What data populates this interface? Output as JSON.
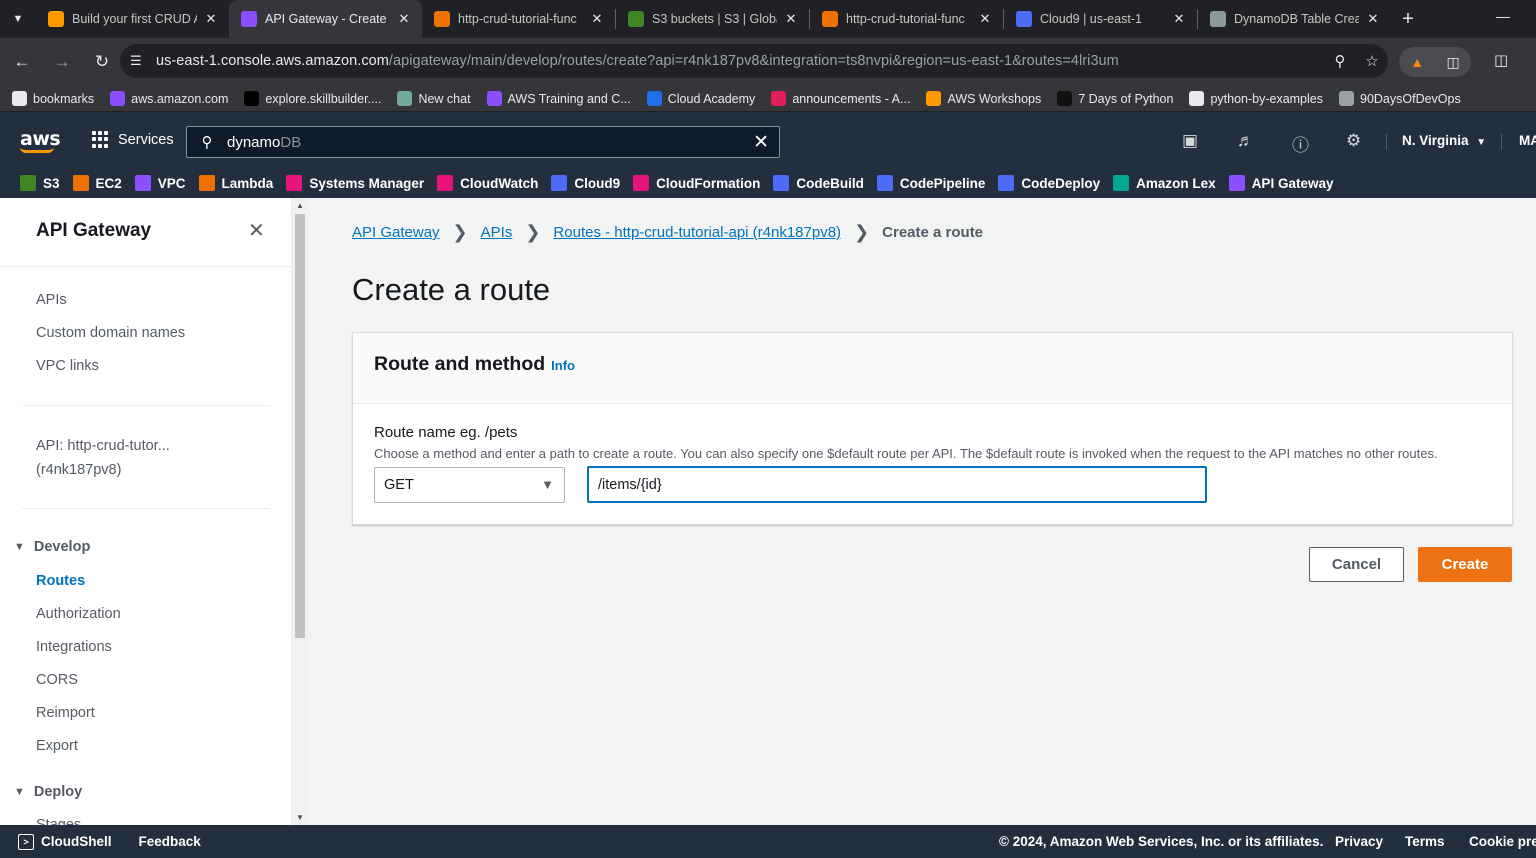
{
  "browser": {
    "tabs": [
      {
        "title": "Build your first CRUD A",
        "color": "#ff9900"
      },
      {
        "title": "API Gateway - Create a",
        "color": "#8c4fff",
        "active": true
      },
      {
        "title": "http-crud-tutorial-func",
        "color": "#ed7100"
      },
      {
        "title": "S3 buckets | S3 | Globa",
        "color": "#3f8624"
      },
      {
        "title": "http-crud-tutorial-func",
        "color": "#ed7100"
      },
      {
        "title": "Cloud9 | us-east-1",
        "color": "#4d6bf7"
      },
      {
        "title": "DynamoDB Table Creat",
        "color": "#8a9a9b"
      }
    ],
    "url_host": "us-east-1.console.aws.amazon.com",
    "url_path": "/apigateway/main/develop/routes/create?api=r4nk187pv8&integration=ts8nvpi&region=us-east-1&routes=4lri3um",
    "bookmarks": [
      {
        "label": "bookmarks",
        "color": "#e8eaed"
      },
      {
        "label": "aws.amazon.com",
        "color": "#8c4fff"
      },
      {
        "label": "explore.skillbuilder....",
        "color": "#000000"
      },
      {
        "label": "New chat",
        "color": "#74aa9c"
      },
      {
        "label": "AWS Training and C...",
        "color": "#8c4fff"
      },
      {
        "label": "Cloud Academy",
        "color": "#1f6feb"
      },
      {
        "label": "announcements - A...",
        "color": "#e01e5a"
      },
      {
        "label": "AWS Workshops",
        "color": "#ff9900"
      },
      {
        "label": "7 Days of Python",
        "color": "#111111"
      },
      {
        "label": "python-by-examples",
        "color": "#e8eaed"
      },
      {
        "label": "90DaysOfDevOps",
        "color": "#9aa0a6"
      }
    ]
  },
  "aws": {
    "logo": "aws",
    "services_label": "Services",
    "search_value": "dynamo",
    "search_ghost": "DB",
    "region": "N. Virginia",
    "account": "MA",
    "favorites": [
      {
        "label": "S3",
        "color": "#3f8624"
      },
      {
        "label": "EC2",
        "color": "#ed7100"
      },
      {
        "label": "VPC",
        "color": "#8c4fff"
      },
      {
        "label": "Lambda",
        "color": "#ed7100"
      },
      {
        "label": "Systems Manager",
        "color": "#e7157b"
      },
      {
        "label": "CloudWatch",
        "color": "#e7157b"
      },
      {
        "label": "Cloud9",
        "color": "#4d6bf7"
      },
      {
        "label": "CloudFormation",
        "color": "#e7157b"
      },
      {
        "label": "CodeBuild",
        "color": "#4d6bf7"
      },
      {
        "label": "CodePipeline",
        "color": "#4d6bf7"
      },
      {
        "label": "CodeDeploy",
        "color": "#4d6bf7"
      },
      {
        "label": "Amazon Lex",
        "color": "#01a88d"
      },
      {
        "label": "API Gateway",
        "color": "#8c4fff"
      }
    ]
  },
  "sidenav": {
    "title": "API Gateway",
    "items_top": [
      "APIs",
      "Custom domain names",
      "VPC links"
    ],
    "api_line1": "API: http-crud-tutor...",
    "api_line2": "(r4nk187pv8)",
    "develop_label": "Develop",
    "develop_items": [
      "Routes",
      "Authorization",
      "Integrations",
      "CORS",
      "Reimport",
      "Export"
    ],
    "deploy_label": "Deploy",
    "deploy_items": [
      "Stages"
    ]
  },
  "main": {
    "breadcrumb": [
      "API Gateway",
      "APIs",
      "Routes - http-crud-tutorial-api (r4nk187pv8)"
    ],
    "breadcrumb_current": "Create a route",
    "title": "Create a route",
    "panel_title": "Route and method",
    "info": "Info",
    "field_label": "Route name eg. /pets",
    "field_desc": "Choose a method and enter a path to create a route. You can also specify one $default route per API. The $default route is invoked when the request to the API matches no other routes.",
    "method": "GET",
    "route_value": "/items/{id}",
    "cancel": "Cancel",
    "create": "Create"
  },
  "footer": {
    "cloudshell": "CloudShell",
    "feedback": "Feedback",
    "copyright": "© 2024, Amazon Web Services, Inc. or its affiliates.",
    "privacy": "Privacy",
    "terms": "Terms",
    "cookies": "Cookie preferences"
  }
}
